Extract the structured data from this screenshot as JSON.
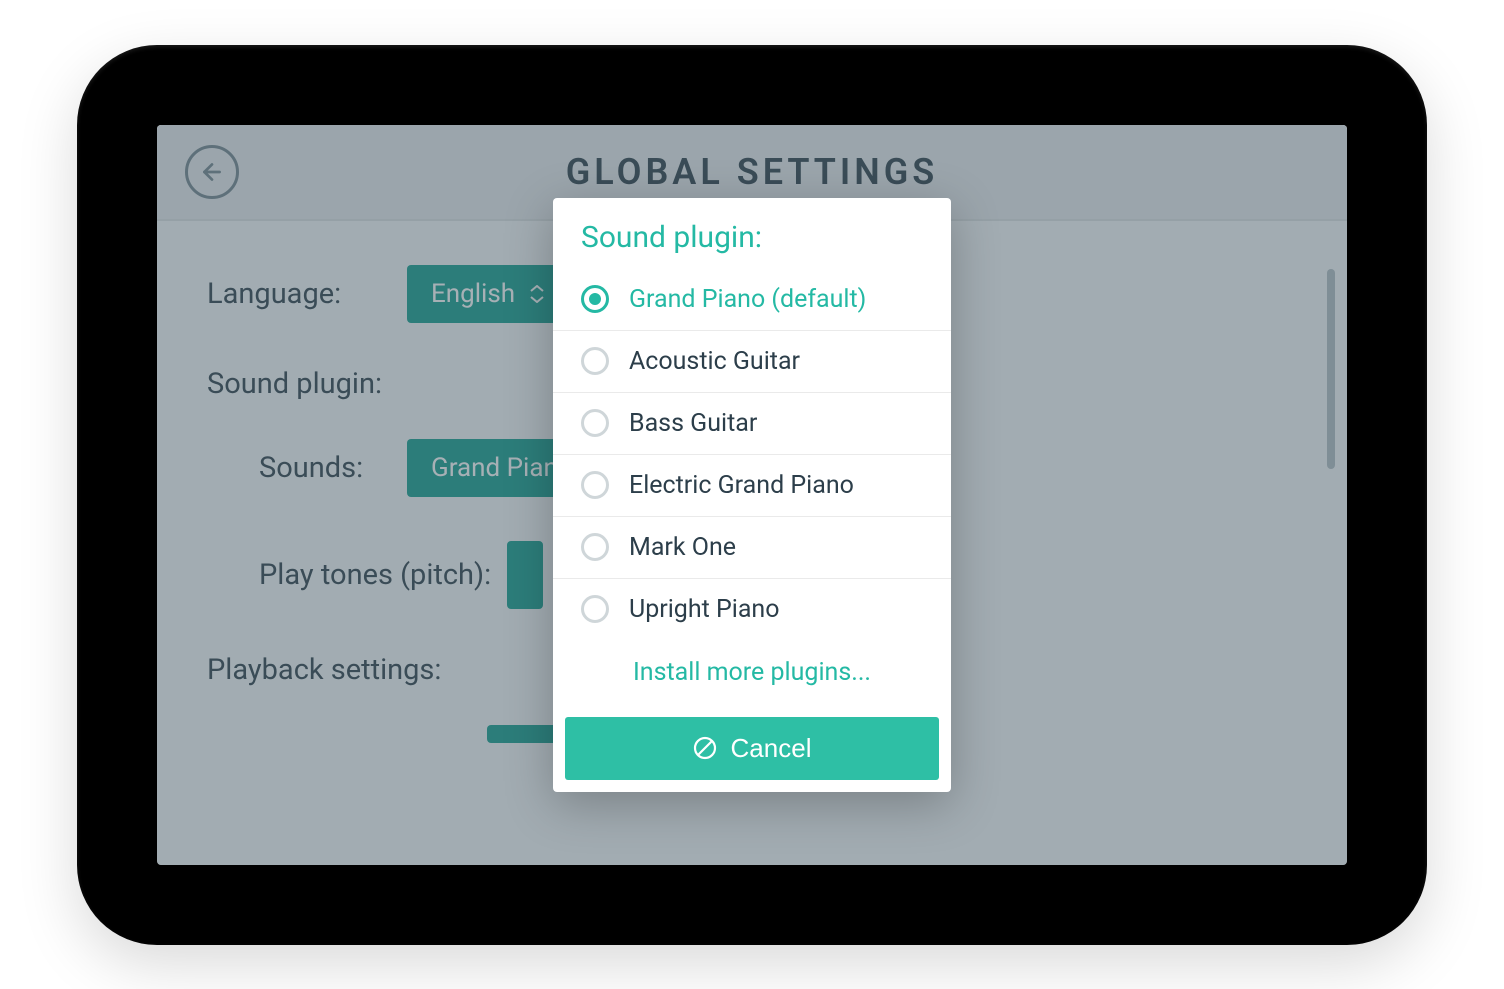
{
  "header": {
    "title": "GLOBAL SETTINGS"
  },
  "settings": {
    "language_label": "Language:",
    "language_value": "English",
    "sound_plugin_section": "Sound plugin:",
    "sounds_label": "Sounds:",
    "sounds_value": "Grand Piano",
    "play_tones_label": "Play tones (pitch):",
    "playback_section": "Playback settings:"
  },
  "modal": {
    "title": "Sound plugin:",
    "options": [
      {
        "label": "Grand Piano (default)",
        "selected": true
      },
      {
        "label": "Acoustic Guitar",
        "selected": false
      },
      {
        "label": "Bass Guitar",
        "selected": false
      },
      {
        "label": "Electric Grand Piano",
        "selected": false
      },
      {
        "label": "Mark One",
        "selected": false
      },
      {
        "label": "Upright Piano",
        "selected": false
      }
    ],
    "install_more": "Install more plugins...",
    "cancel": "Cancel"
  }
}
